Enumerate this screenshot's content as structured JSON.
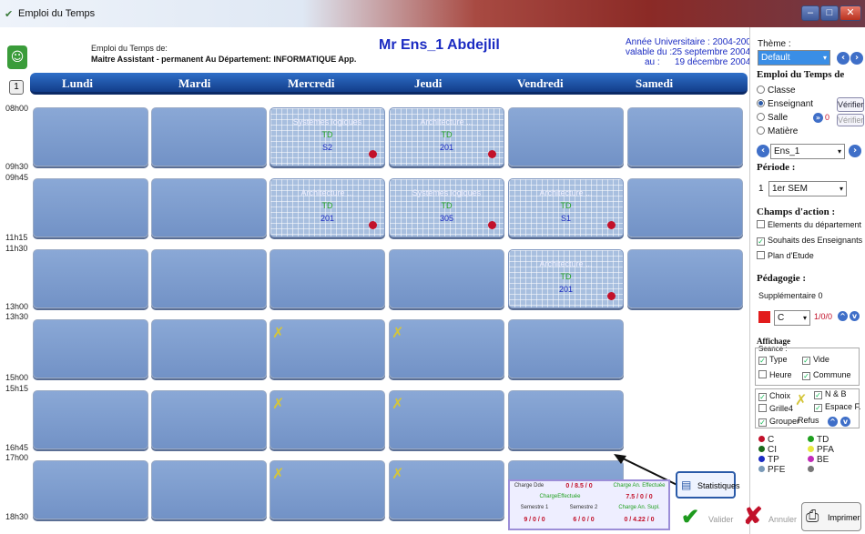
{
  "window": {
    "title": "Emploi du Temps",
    "min": "–",
    "max": "□",
    "close": "✕"
  },
  "header": {
    "emploi_label": "Emploi du Temps de:",
    "position": "Maitre Assistant - permanent Au Département: INFORMATIQUE App.",
    "teacher": "Mr Ens_1 Abdejlil",
    "annee": "Année Universitaire : 2004-2005",
    "valable_label": "valable du :",
    "valable_du": "25 septembre 2004",
    "au_label": "au :",
    "au": "19 décembre 2004",
    "week": "1"
  },
  "days": [
    "Lundi",
    "Mardi",
    "Mercredi",
    "Jeudi",
    "Vendredi",
    "Samedi"
  ],
  "times": [
    "08h00",
    "09h30",
    "09h45",
    "11h15",
    "11h30",
    "13h00",
    "13h30",
    "15h00",
    "15h15",
    "16h45",
    "17h00",
    "18h30"
  ],
  "courses": [
    {
      "row": 0,
      "col": 2,
      "name": "Systèmes logiques",
      "type": "TD",
      "room": "S2"
    },
    {
      "row": 0,
      "col": 3,
      "name": "Architecture ...",
      "type": "TD",
      "room": "201"
    },
    {
      "row": 1,
      "col": 2,
      "name": "Architecture ...",
      "type": "TD",
      "room": "201"
    },
    {
      "row": 1,
      "col": 3,
      "name": "Systèmes logiques",
      "type": "TD",
      "room": "305"
    },
    {
      "row": 1,
      "col": 4,
      "name": "Architecture ...",
      "type": "TD",
      "room": "S1"
    },
    {
      "row": 2,
      "col": 4,
      "name": "Architecture ...",
      "type": "TD",
      "room": "201"
    }
  ],
  "refus": [
    {
      "row": 3,
      "col": 2
    },
    {
      "row": 3,
      "col": 3
    },
    {
      "row": 4,
      "col": 2
    },
    {
      "row": 4,
      "col": 3
    },
    {
      "row": 5,
      "col": 2
    },
    {
      "row": 5,
      "col": 3
    }
  ],
  "panel": {
    "theme_label": "Thème :",
    "theme_value": "Default",
    "emploi_title": "Emploi du Temps de",
    "radio_classe": "Classe",
    "radio_enseignant": "Enseignant",
    "radio_salle": "Salle",
    "radio_matiere": "Matière",
    "verifier": "Vérifier",
    "salle_count": "0",
    "enseignant_value": "Ens_1",
    "periode_title": "Période :",
    "periode_num": "1",
    "periode_value": "1er SEM",
    "champs_title": "Champs d'action :",
    "champ_elements": "Elements du département",
    "champ_souhaits": "Souhaits des Enseignants",
    "champ_plan": "Plan d'Etude",
    "pedagogie_title": "Pédagogie :",
    "supplementaire": "Supplémentaire 0",
    "ped_select": "C",
    "ped_count": "1/0/0",
    "affichage_title": "Affichage",
    "seance_label": "Seance :",
    "opt_type": "Type",
    "opt_vide": "Vide",
    "opt_heure": "Heure",
    "opt_commune": "Commune",
    "opt_choix": "Choix",
    "opt_nb": "N & B",
    "opt_grille": "Grille4",
    "opt_espace": "Espace F.",
    "opt_grouper": "Grouper",
    "opt_refus": "Refus",
    "legend": [
      {
        "label": "C",
        "color": "#c2112a"
      },
      {
        "label": "TD",
        "color": "#1fa01f"
      },
      {
        "label": "CI",
        "color": "#1b6a1b"
      },
      {
        "label": "PFA",
        "color": "#e8e840"
      },
      {
        "label": "TP",
        "color": "#1b2bc2"
      },
      {
        "label": "BE",
        "color": "#c22ab8"
      },
      {
        "label": "PFE",
        "color": "#7a9ab8"
      },
      {
        "label": "",
        "color": "#777777"
      }
    ]
  },
  "stats": {
    "charge_dde_label": "Charge Dde",
    "charge_dde_value": "0 / 8.5 / 0",
    "charge_an_eff_label": "Charge An. Effectuée",
    "charge_eff_label": "ChargeEffectuée",
    "charge_an_eff_value": "7.5 / 0 / 0",
    "semestre1_label": "Semestre 1",
    "semestre2_label": "Semestre 2",
    "charge_an_supl_label": "Charge An. Supl.",
    "semestre1_value": "9 / 0 / 0",
    "semestre2_value": "6 / 0 / 0",
    "charge_an_supl_value": "0 / 4.22 / 0"
  },
  "actions": {
    "statistiques": "Statistiques",
    "valider": "Valider",
    "annuler": "Annuler",
    "imprimer": "Imprimer"
  }
}
